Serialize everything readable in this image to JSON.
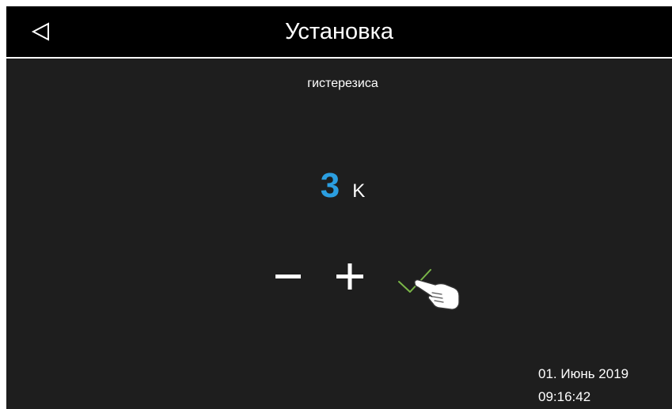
{
  "header": {
    "title": "Установка",
    "back_icon": "triangle-left-icon"
  },
  "setting": {
    "label": "гистерезиса",
    "value": "3",
    "unit": "K",
    "value_color": "#2b9ee0"
  },
  "controls": {
    "decrease_icon": "minus-icon",
    "increase_icon": "plus-icon",
    "confirm_icon": "check-icon",
    "confirm_color": "#7ab648"
  },
  "status": {
    "date": "01. Июнь 2019",
    "time": "09:16:42"
  }
}
